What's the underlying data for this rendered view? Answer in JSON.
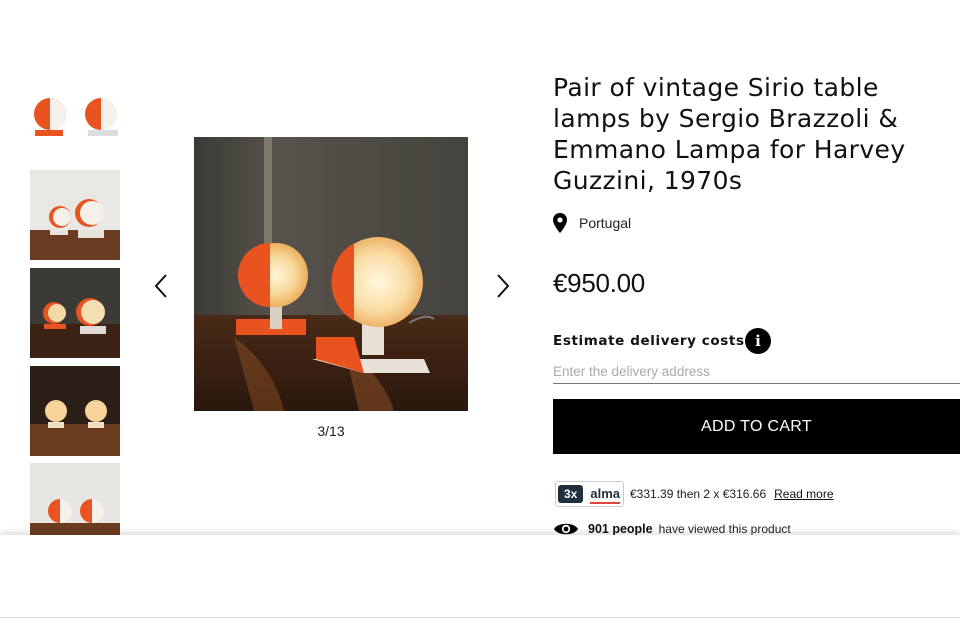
{
  "gallery": {
    "counter": "3/13",
    "prev_icon": "chevron-left-icon",
    "next_icon": "chevron-right-icon",
    "thumbnail_count": 5
  },
  "product": {
    "title": "Pair of vintage Sirio table lamps by Sergio Brazzoli & Emmano Lampa for Harvey Guzzini, 1970s",
    "location": "Portugal",
    "location_icon": "map-pin-icon",
    "price": "€950.00"
  },
  "delivery": {
    "label": "Estimate delivery costs",
    "info_icon_glyph": "i",
    "placeholder": "Enter the delivery address"
  },
  "cart": {
    "add_label": "ADD TO CART"
  },
  "payment": {
    "badge_count": "3x",
    "provider": "alma",
    "installments": "€331.39 then 2 x €316.66",
    "read_more": "Read more"
  },
  "views": {
    "icon": "eye-icon",
    "count": "901 people",
    "text": "have viewed this product"
  },
  "colors": {
    "lamp_orange": "#e8531f",
    "button_bg": "#000000",
    "alma_navy": "#1f2f3c",
    "alma_red": "#e0433b"
  }
}
